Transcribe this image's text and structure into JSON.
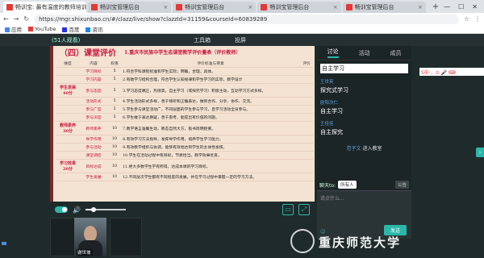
{
  "browser": {
    "tabs": [
      {
        "label": "畅训宝: 最有温度的教师培训【"
      },
      {
        "label": "畅训宝管理后台"
      },
      {
        "label": "畅训宝管理后台"
      },
      {
        "label": "畅训宝管理后台"
      },
      {
        "label": "畅训宝管理后台"
      }
    ],
    "new_tab": "+",
    "url": "https://mgr.shixunbao.cn/#/clazz/live/show?clazzId=31159&courseId=60839289",
    "bookmarks": [
      "应用",
      "YouTube",
      "百度",
      "资讯"
    ]
  },
  "topbar": {
    "online": "(51人观看)",
    "tools": [
      "工具箱",
      "投屏"
    ]
  },
  "slide": {
    "title": "（四）课堂评价",
    "subtitle": "1.重庆市民族中学生态课堂教学评价量表（评价教师）",
    "headers": [
      "维度",
      "内容",
      "权重",
      "评价标准与要素",
      "评价"
    ],
    "rows": [
      {
        "dim": "",
        "item": "学习目标",
        "weight": "5",
        "desc": "1.符合学科课程标准和学生实际；明确，合理，具体。"
      },
      {
        "dim": "",
        "item": "学习内容",
        "weight": "5",
        "desc": "2.有助学习结构合理，符合学生认知规律和学生学习的实际，教学设计"
      },
      {
        "dim": "学生发展40分",
        "item": "参与态度",
        "weight": "5",
        "desc": "3.学习态度端正，热情高，自主学习（或探究学习）积极主动，互动学习方式多样。"
      },
      {
        "dim": "",
        "item": "活动形式",
        "weight": "5",
        "desc": "4.学生活动形式多样，善于倾听和正确表达，做到合作、分享、协作、交流。"
      },
      {
        "dim": "",
        "item": "参与广度",
        "weight": "5",
        "desc": "5.学生参与课堂活动广，不同层面的学生参与学习，且学习活动全员参与。"
      },
      {
        "dim": "",
        "item": "参与深度",
        "weight": "5",
        "desc": "6.学生敢于表达质疑，善于思考，能提出有价值的问题。"
      },
      {
        "dim": "教师素养30分",
        "item": "教师素养",
        "weight": "10",
        "desc": "7.教学语言准确生动，教态自然大方，板书简明扼要。"
      },
      {
        "dim": "",
        "item": "导学作用",
        "weight": "10",
        "desc": "8.有效学习方法指导，发挥导学作用，培养学生学习能力。"
      },
      {
        "dim": "",
        "item": "参与活动",
        "weight": "10",
        "desc": "9.有效教学组织与协调，能够有效地达到学生的主体性发挥。"
      },
      {
        "dim": "",
        "item": "课堂调控",
        "weight": "10",
        "desc": "10.学生在活动过程中有目标，节奏恰当，教学效果优良。"
      },
      {
        "dim": "学习效果20分",
        "item": "目标达成",
        "weight": "10",
        "desc": "11.绝大多数学生学有所得，达成本课的学习目标。"
      },
      {
        "dim": "",
        "item": "学生发展",
        "weight": "10",
        "desc": "12.不同层次学生都有不同程度的发展，并在学习过程中掌握一定的学习方法。"
      }
    ]
  },
  "panel": {
    "tabs": [
      "讨论",
      "活动",
      "成员"
    ],
    "messages": [
      {
        "user": "",
        "text": "自主学习"
      },
      {
        "user": "王世英",
        "text": "探究式学习"
      },
      {
        "user": "欧阳次仁",
        "text": "自主学习"
      },
      {
        "user": "王佳佳",
        "text": "自主探究"
      }
    ],
    "enter": {
      "user": "范子文",
      "text": "进入教室"
    },
    "chat_to_label": "聊天to:",
    "chat_to_value": "所有人",
    "notice": "公告",
    "chat_placeholder": "说点什么...",
    "send_label": "发送"
  },
  "ime": {
    "text": "S中·，⊙ 🎤 ⌨"
  },
  "webcam": {
    "name": "谢世坡"
  },
  "watermark": "重庆师范大学",
  "colors": {
    "accent": "#2bb7a9",
    "title_red": "#c9183d"
  }
}
